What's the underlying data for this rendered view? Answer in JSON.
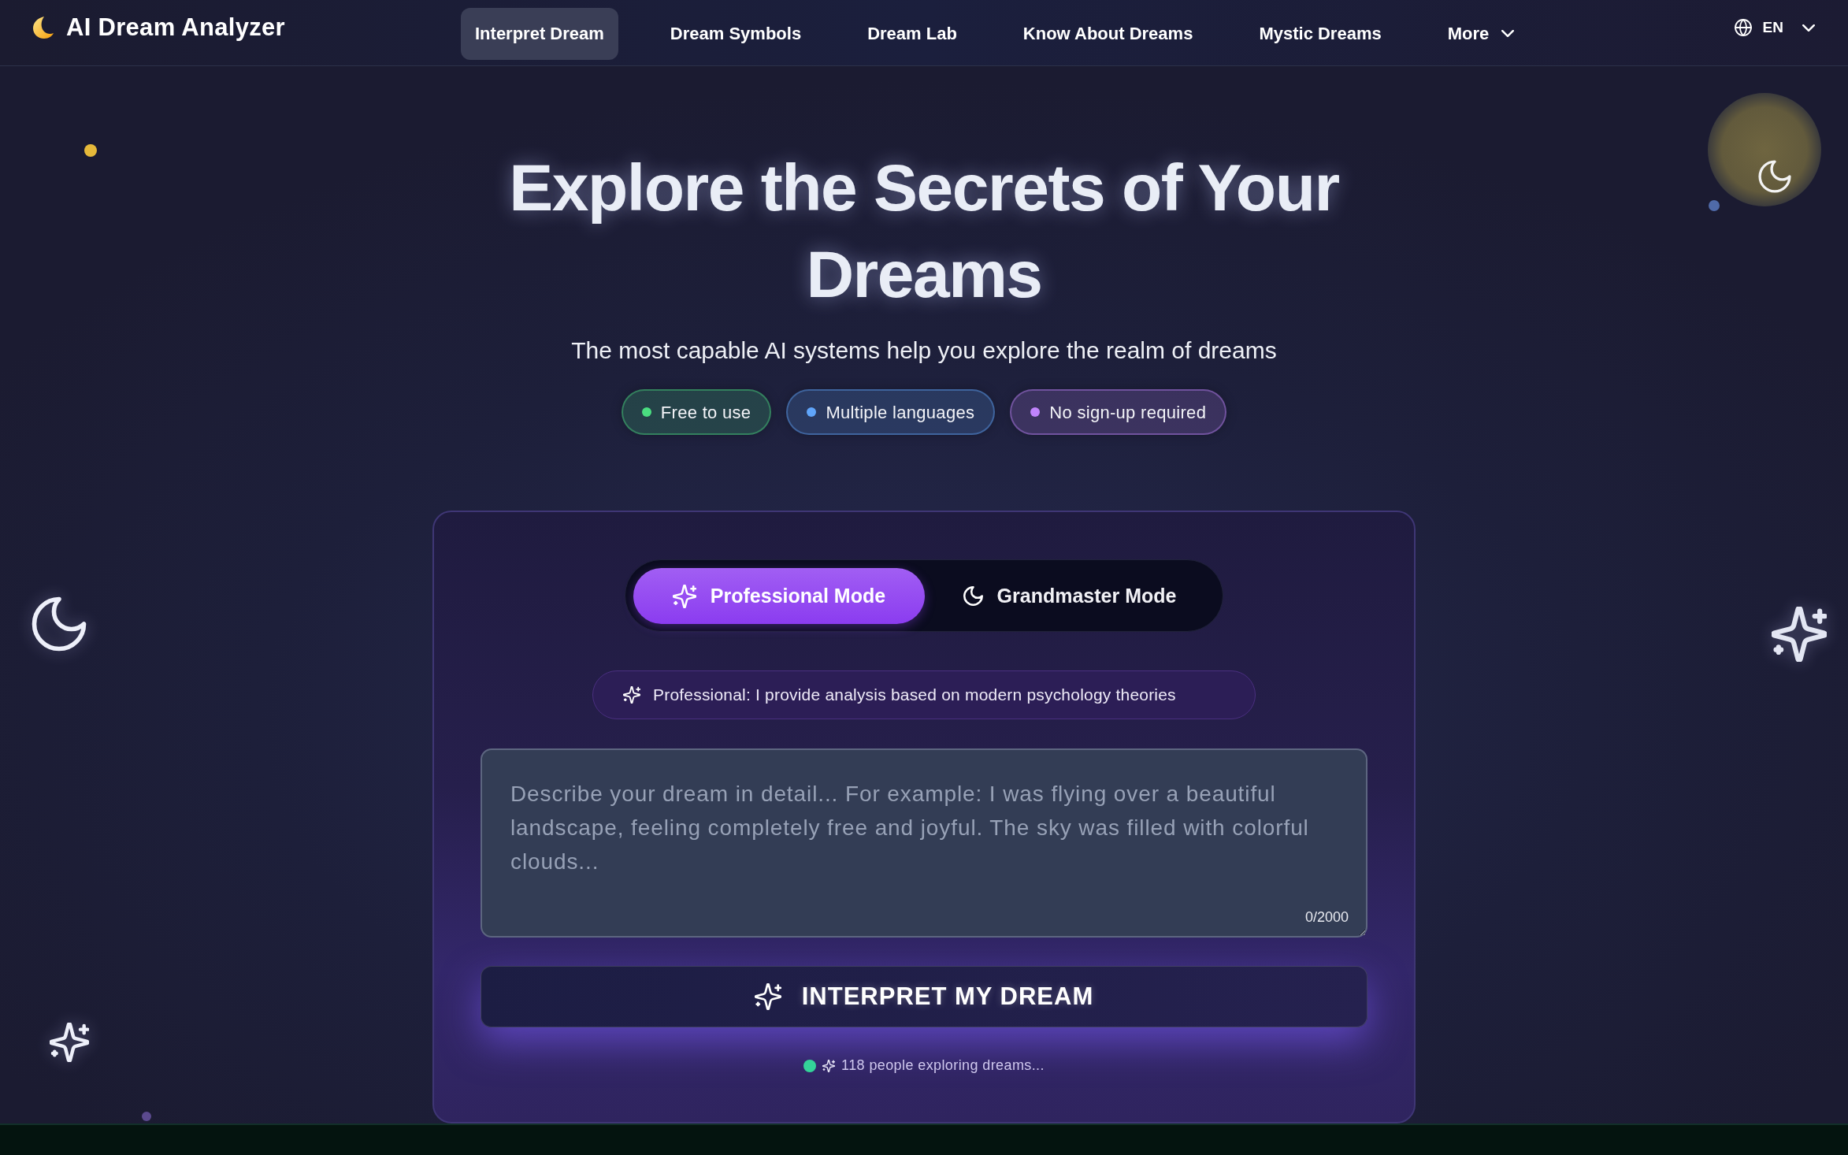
{
  "navbar": {
    "brand": "AI Dream Analyzer",
    "items": [
      {
        "label": "Interpret Dream",
        "selected": true,
        "kind": "link"
      },
      {
        "label": "Dream Symbols",
        "selected": false,
        "kind": "link"
      },
      {
        "label": "Dream Lab",
        "selected": false,
        "kind": "link"
      },
      {
        "label": "Know About Dreams",
        "selected": false,
        "kind": "link"
      },
      {
        "label": "Mystic Dreams",
        "selected": false,
        "kind": "link"
      },
      {
        "label": "More",
        "selected": false,
        "kind": "dropdown"
      }
    ],
    "language": "EN"
  },
  "hero": {
    "title": "Explore the Secrets of Your Dreams",
    "subtitle": "The most capable AI systems help you explore the realm of dreams",
    "badges": [
      {
        "label": "Free to use",
        "color": "#4ade80"
      },
      {
        "label": "Multiple languages",
        "color": "#60a5fa"
      },
      {
        "label": "No sign-up required",
        "color": "#c084fc"
      }
    ]
  },
  "interpreter": {
    "modes": [
      {
        "label": "Professional Mode",
        "selected": true
      },
      {
        "label": "Grandmaster Mode",
        "selected": false
      }
    ],
    "mode_info": "Professional: I provide analysis based on modern psychology theories",
    "dream_input": {
      "placeholder": "Describe your dream in detail... For example: I was flying over a beautiful landscape, feeling completely free and joyful. The sky was filled with colorful clouds...",
      "counter": "0/2000"
    },
    "submit_button": "INTERPRET MY DREAM",
    "activity": "118 people exploring dreams..."
  }
}
